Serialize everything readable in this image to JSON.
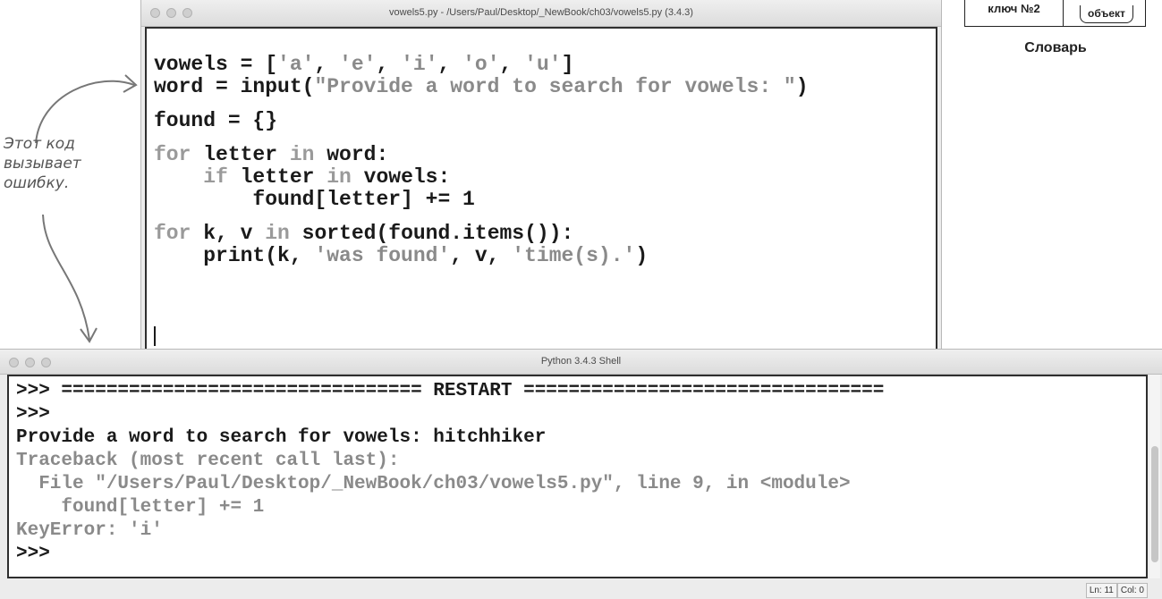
{
  "editor": {
    "title": "vowels5.py - /Users/Paul/Desktop/_NewBook/ch03/vowels5.py (3.4.3)",
    "code": [
      [
        {
          "t": "vowels = [",
          "c": "n"
        },
        {
          "t": "'a'",
          "c": "s"
        },
        {
          "t": ", ",
          "c": "n"
        },
        {
          "t": "'e'",
          "c": "s"
        },
        {
          "t": ", ",
          "c": "n"
        },
        {
          "t": "'i'",
          "c": "s"
        },
        {
          "t": ", ",
          "c": "n"
        },
        {
          "t": "'o'",
          "c": "s"
        },
        {
          "t": ", ",
          "c": "n"
        },
        {
          "t": "'u'",
          "c": "s"
        },
        {
          "t": "]",
          "c": "n"
        }
      ],
      [
        {
          "t": "word = input(",
          "c": "n"
        },
        {
          "t": "\"Provide a word to search for vowels: \"",
          "c": "s"
        },
        {
          "t": ")",
          "c": "n"
        }
      ],
      [],
      [
        {
          "t": "found = {}",
          "c": "n"
        }
      ],
      [],
      [
        {
          "t": "for",
          "c": "k"
        },
        {
          "t": " letter ",
          "c": "n"
        },
        {
          "t": "in",
          "c": "k"
        },
        {
          "t": " word:",
          "c": "n"
        }
      ],
      [
        {
          "t": "    ",
          "c": "n"
        },
        {
          "t": "if",
          "c": "k"
        },
        {
          "t": " letter ",
          "c": "n"
        },
        {
          "t": "in",
          "c": "k"
        },
        {
          "t": " vowels:",
          "c": "n"
        }
      ],
      [
        {
          "t": "        found[letter] += 1",
          "c": "n"
        }
      ],
      [],
      [
        {
          "t": "for",
          "c": "k"
        },
        {
          "t": " k, v ",
          "c": "n"
        },
        {
          "t": "in",
          "c": "k"
        },
        {
          "t": " sorted(found.items()):",
          "c": "n"
        }
      ],
      [
        {
          "t": "    print(k, ",
          "c": "n"
        },
        {
          "t": "'was found'",
          "c": "s"
        },
        {
          "t": ", v, ",
          "c": "n"
        },
        {
          "t": "'time(s).'",
          "c": "s"
        },
        {
          "t": ")",
          "c": "n"
        }
      ]
    ]
  },
  "shell": {
    "title": "Python 3.4.3 Shell",
    "lines": [
      {
        "text": ">>> ================================ RESTART ================================",
        "style": "normal"
      },
      {
        "text": ">>>",
        "style": "normal"
      },
      {
        "text": "Provide a word to search for vowels: hitchhiker",
        "style": "normal"
      },
      {
        "text": "Traceback (most recent call last):",
        "style": "err"
      },
      {
        "text": "  File \"/Users/Paul/Desktop/_NewBook/ch03/vowels5.py\", line 9, in <module>",
        "style": "err"
      },
      {
        "text": "    found[letter] += 1",
        "style": "err"
      },
      {
        "text": "KeyError: 'i'",
        "style": "err"
      },
      {
        "text": ">>>",
        "style": "normal"
      }
    ],
    "status_ln": "Ln: 11",
    "status_col": "Col: 0"
  },
  "annotation": {
    "lines": [
      "Этот код",
      "вызывает",
      "ошибку."
    ]
  },
  "dictionary_diagram": {
    "key_label": "ключ №2",
    "value_label": "объект",
    "caption": "Словарь"
  },
  "colors": {
    "keyword": "#9a9a9a",
    "string": "#8a8a8a",
    "text": "#1a1a1a"
  }
}
